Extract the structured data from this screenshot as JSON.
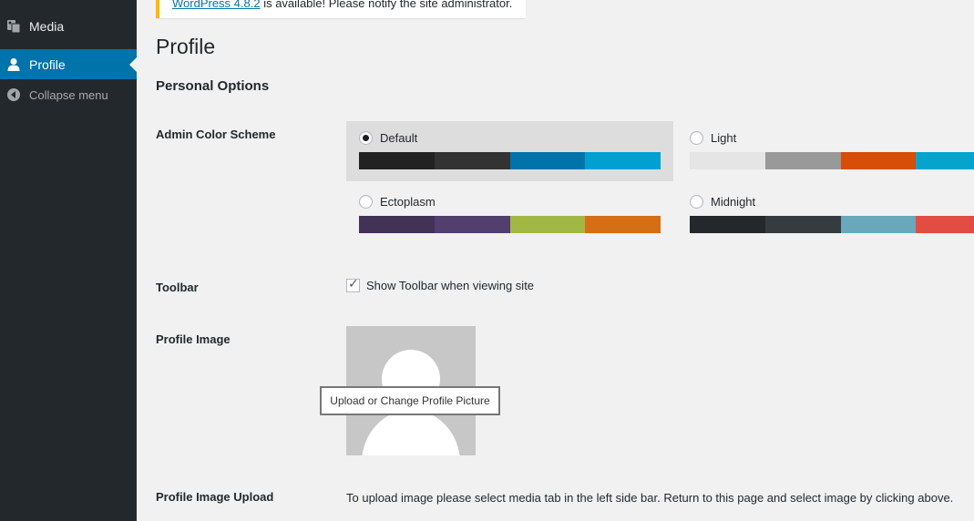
{
  "sidebar": {
    "items": [
      {
        "label": "Media",
        "icon": "media-icon"
      },
      {
        "label": "Profile",
        "icon": "user-icon",
        "active": true
      },
      {
        "label": "Collapse menu",
        "icon": "collapse-icon"
      }
    ]
  },
  "notice": {
    "link_text": "WordPress 4.8.2",
    "text": " is available! Please notify the site administrator."
  },
  "page": {
    "title": "Profile",
    "section_title": "Personal Options"
  },
  "color_scheme": {
    "label": "Admin Color Scheme",
    "schemes": [
      {
        "name": "Default",
        "selected": true,
        "colors": [
          "#222222",
          "#333333",
          "#0073aa",
          "#00a0d2"
        ]
      },
      {
        "name": "Light",
        "selected": false,
        "colors": [
          "#e5e5e5",
          "#999999",
          "#d64e07",
          "#04a4cc"
        ]
      },
      {
        "name": "Ectoplasm",
        "selected": false,
        "colors": [
          "#413256",
          "#523f6d",
          "#a3b745",
          "#d46f15"
        ]
      },
      {
        "name": "Midnight",
        "selected": false,
        "colors": [
          "#25282b",
          "#363b3f",
          "#69a8bb",
          "#e14d43"
        ]
      }
    ]
  },
  "toolbar": {
    "label": "Toolbar",
    "checkbox_label": "Show Toolbar when viewing site",
    "checked": true
  },
  "profile_image": {
    "label": "Profile Image",
    "tooltip": "Upload or Change Profile Picture"
  },
  "profile_image_upload": {
    "label": "Profile Image Upload",
    "text": "To upload image please select media tab in the left side bar. Return to this page and select image by clicking above."
  }
}
